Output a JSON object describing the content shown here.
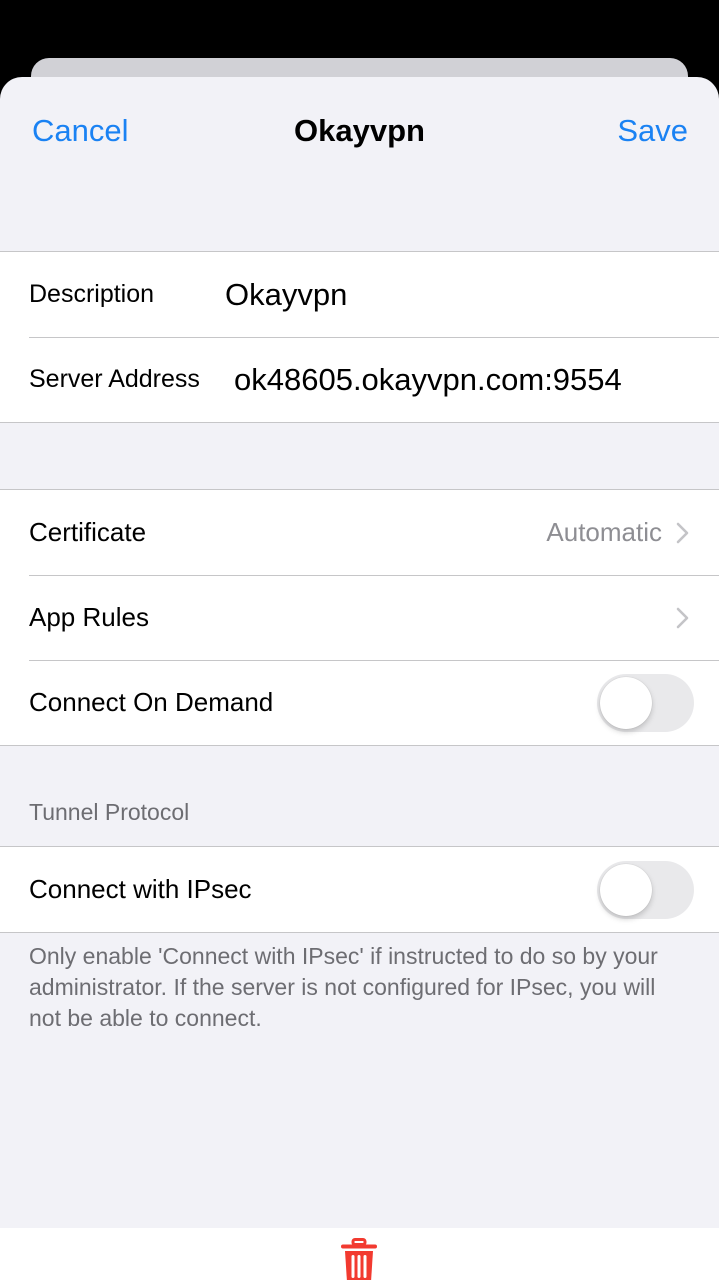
{
  "nav": {
    "cancel_label": "Cancel",
    "title": "Okayvpn",
    "save_label": "Save"
  },
  "fields": {
    "description_label": "Description",
    "description_value": "Okayvpn",
    "server_label": "Server Address",
    "server_value": "ok48605.okayvpn.com:9554"
  },
  "settings": {
    "certificate_label": "Certificate",
    "certificate_value": "Automatic",
    "app_rules_label": "App Rules",
    "connect_on_demand_label": "Connect On Demand",
    "connect_on_demand_on": false
  },
  "tunnel": {
    "header": "Tunnel Protocol",
    "ipsec_label": "Connect with IPsec",
    "ipsec_on": false,
    "note": "Only enable 'Connect with IPsec' if instructed to do so by your administrator. If the server is not configured for IPsec, you will not be able to connect."
  },
  "colors": {
    "accent": "#1a82f3",
    "destructive": "#f23a30",
    "toggle_off": "#e9e9eb"
  },
  "icons": {
    "chevron": "chevron-right-icon",
    "delete": "trash-icon"
  }
}
